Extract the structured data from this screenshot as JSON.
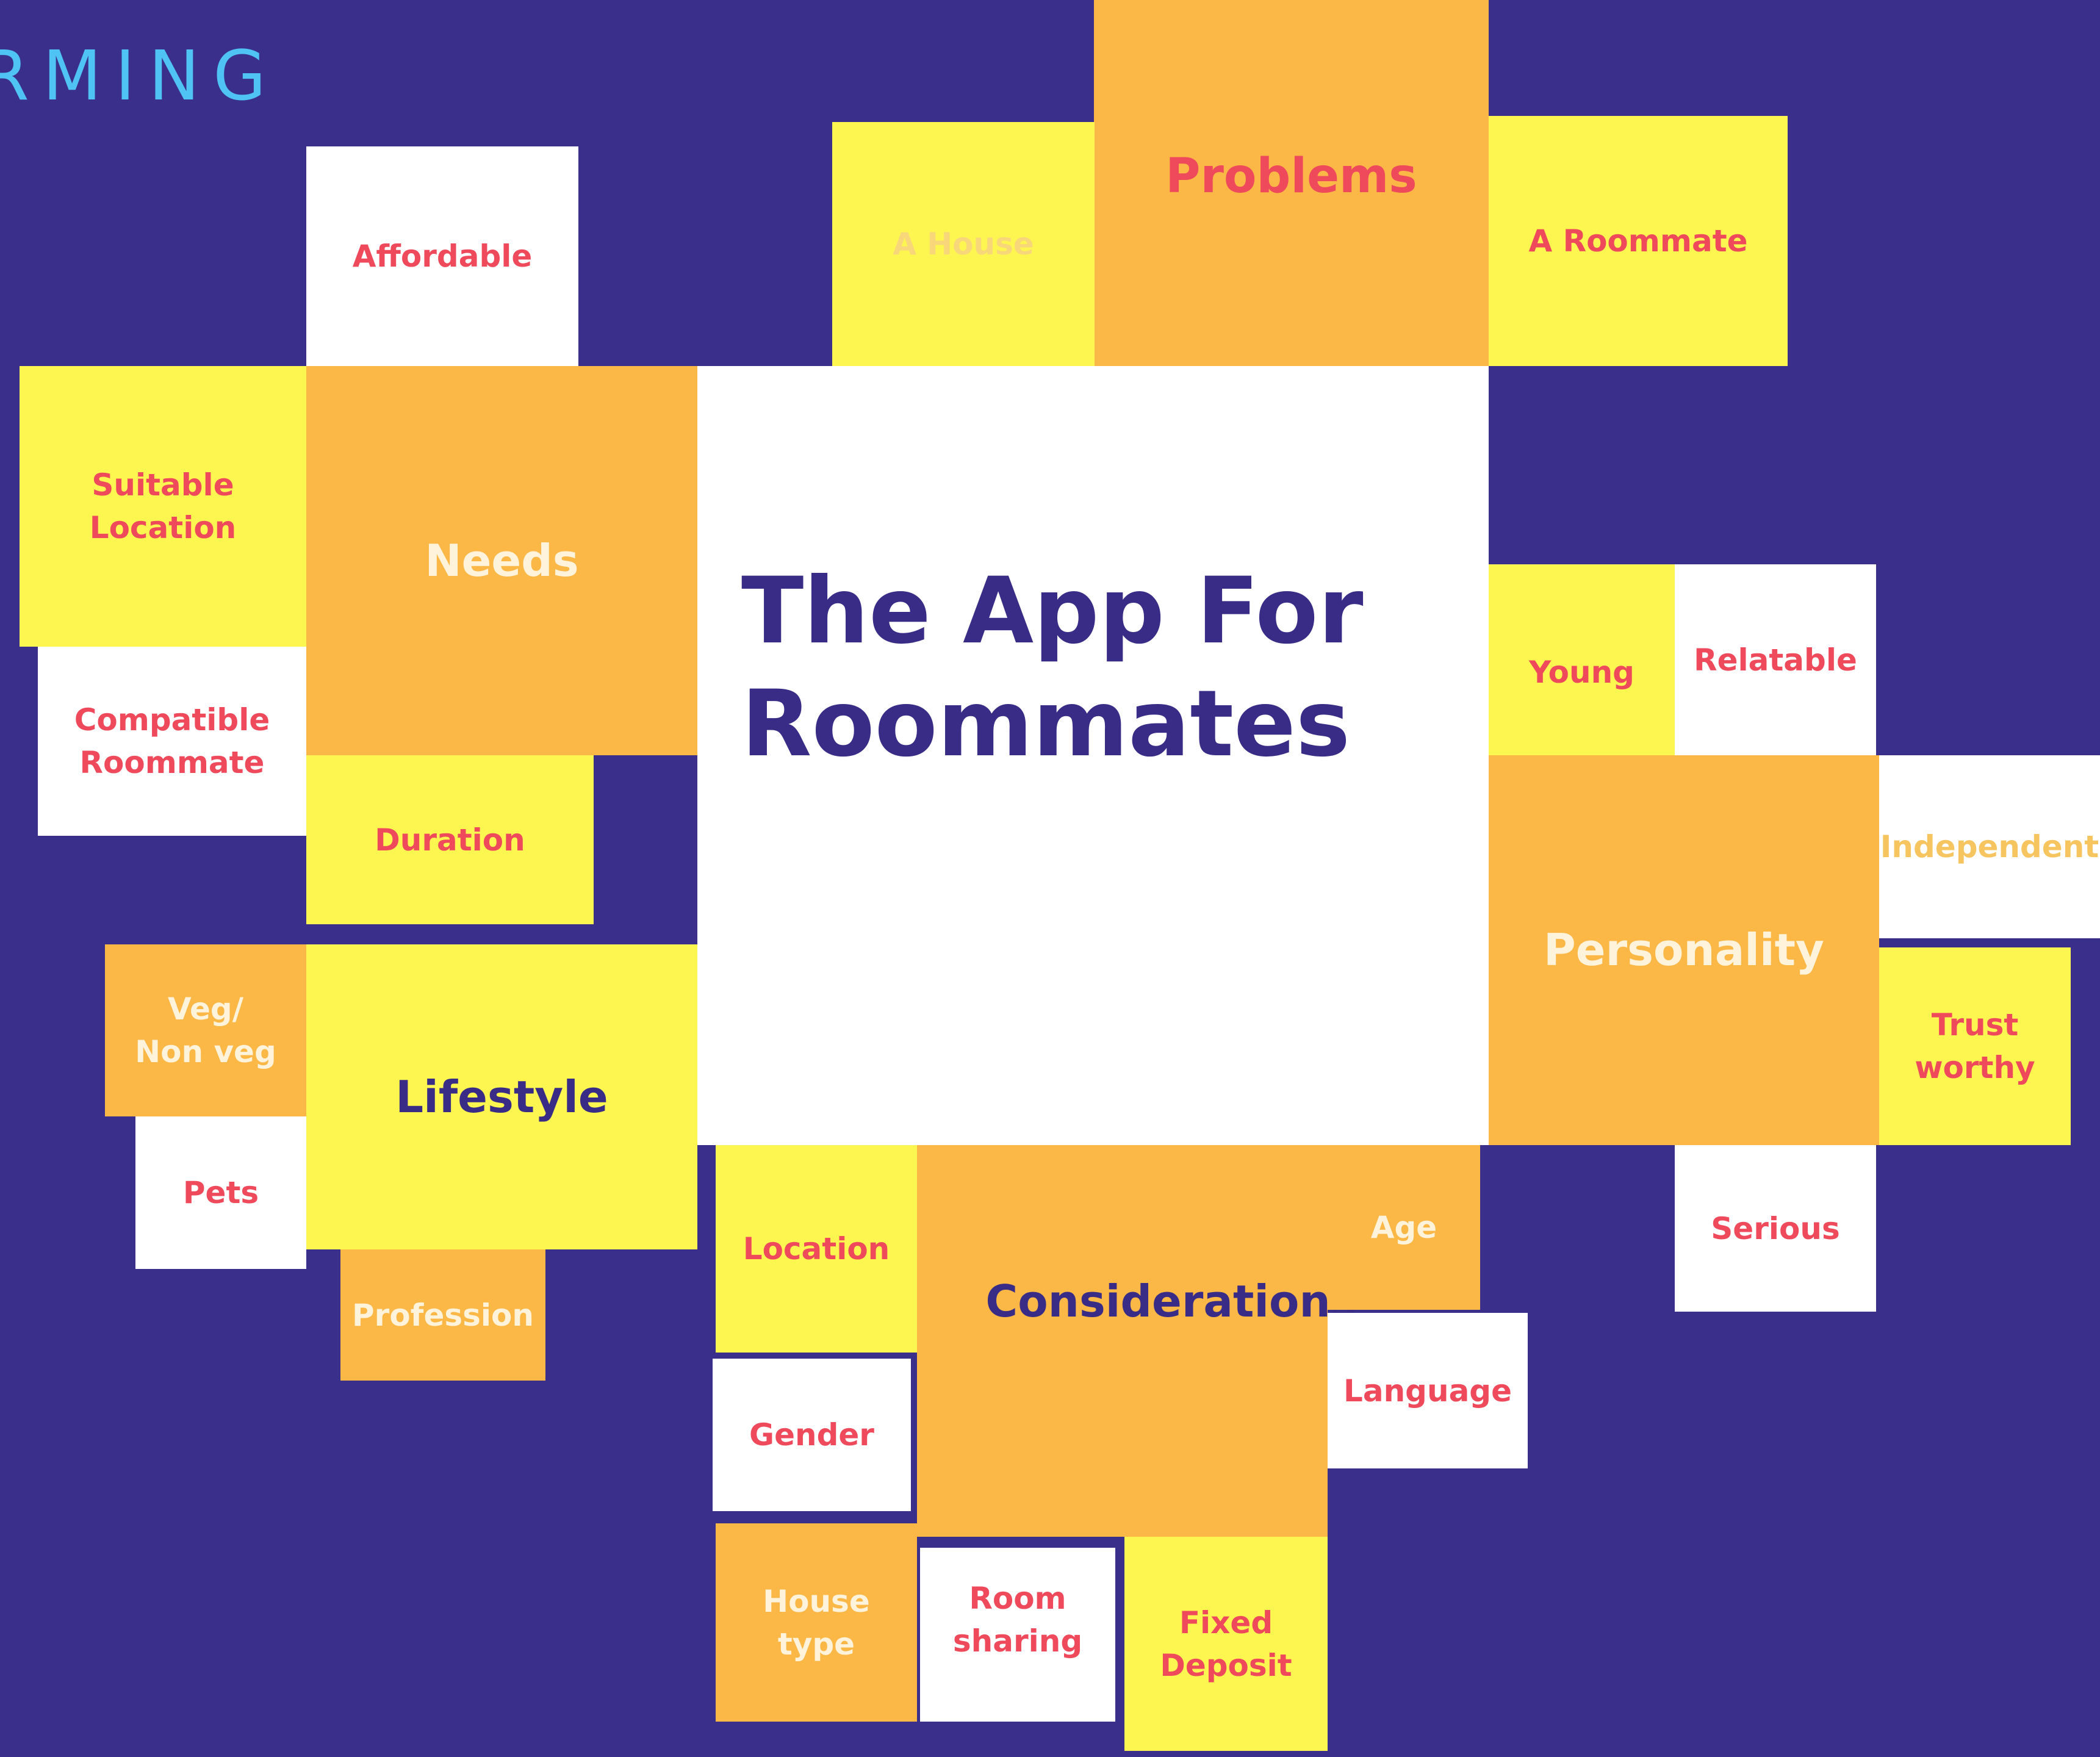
{
  "page": {
    "title": "RMING",
    "background_color": "#3b2f8c"
  },
  "center": {
    "title": "The App For\nRoommates"
  },
  "problems": {
    "hub": "Problems",
    "items": [
      "A House",
      "A Roommate"
    ]
  },
  "needs": {
    "hub": "Needs",
    "items": [
      "Affordable",
      "Suitable\nLocation",
      "Compatible\nRoommate",
      "Duration"
    ]
  },
  "lifestyle": {
    "hub": "Lifestyle",
    "items": [
      "Veg/\nNon veg",
      "Pets",
      "Profession"
    ]
  },
  "personality": {
    "hub": "Personality",
    "items": [
      "Young",
      "Relatable",
      "Independent",
      "Trust\nworthy",
      "Serious"
    ]
  },
  "considerations": {
    "hub": "Considerations",
    "items": [
      "Location",
      "Gender",
      "Age",
      "Language",
      "House\ntype",
      "Room\nsharing",
      "Fixed\nDeposit"
    ]
  },
  "colors": {
    "orange": "#fcb847",
    "yellow": "#fdf650",
    "white": "#ffffff",
    "red_text": "#ee4a5c",
    "navy_text": "#382c86",
    "title_blue": "#4fc3f4"
  }
}
